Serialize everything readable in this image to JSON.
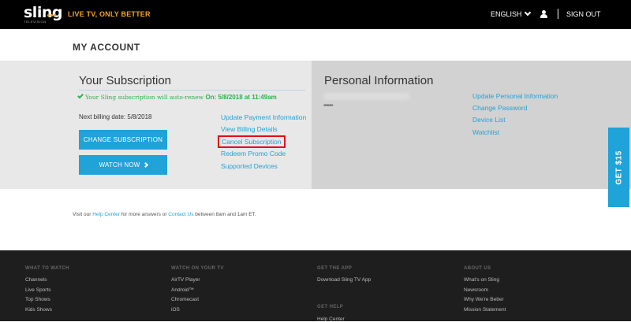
{
  "header": {
    "logo_text": "sling",
    "logo_subtext": "TELEVISION",
    "tagline": "LIVE TV, ONLY BETTER",
    "language": "ENGLISH",
    "sign_out": "SIGN OUT"
  },
  "page_title": "MY ACCOUNT",
  "subscription": {
    "title": "Your Subscription",
    "autorenew_text": "Your Sling subscription will auto-renew",
    "autorenew_date": "On: 5/8/2018 at 11:49am",
    "next_billing": "Next billing date: 5/8/2018",
    "change_button": "CHANGE SUBSCRIPTION",
    "watch_button": "WATCH NOW",
    "links": [
      "Update Payment Information",
      "View Billing Details",
      "Cancel Subscription",
      "Redeem Promo Code",
      "Supported Devices"
    ]
  },
  "personal": {
    "title": "Personal Information",
    "password_mask": "••••••••",
    "links": [
      "Update Personal Information",
      "Change Password",
      "Device List",
      "Watchlist"
    ]
  },
  "get_offer": "GET $15",
  "help": {
    "prefix": "Visit our",
    "help_center": "Help Center",
    "middle": "for more answers or",
    "contact": "Contact Us",
    "suffix": "between 8am and 1am ET."
  },
  "footer": {
    "columns": [
      {
        "heading": "WHAT TO WATCH",
        "items": [
          "Channels",
          "Live Sports",
          "Top Shows",
          "Kids Shows"
        ]
      },
      {
        "heading": "WATCH ON YOUR TV",
        "items": [
          "AirTV Player",
          "Android™",
          "Chromecast",
          "iOS"
        ]
      },
      {
        "heading": "GET THE APP",
        "items": [
          "Download Sling TV App"
        ]
      },
      {
        "heading": "ABOUT US",
        "items": [
          "What's on Sling",
          "Newsroom",
          "Why We're Better",
          "Mission Statement"
        ]
      }
    ],
    "help_heading": "GET HELP",
    "help_item": "Help Center"
  },
  "colors": {
    "accent": "#1fa3d8",
    "brand_orange": "#f7a21b",
    "success_green": "#2db34a",
    "highlight_red": "#e2001a"
  }
}
